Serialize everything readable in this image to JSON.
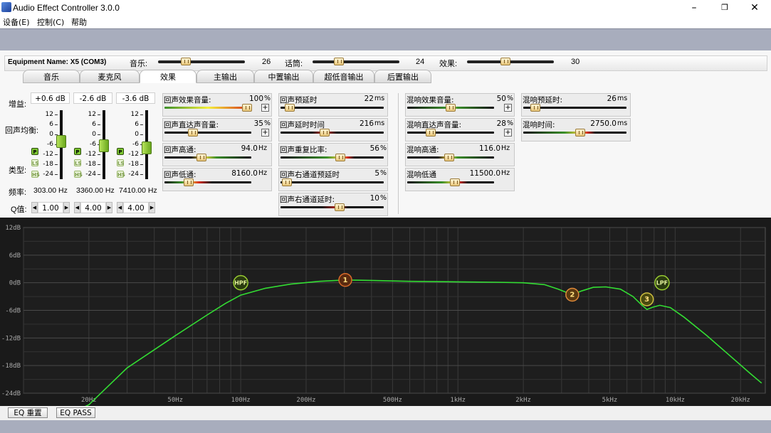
{
  "window": {
    "title": "Audio Effect Controller 3.0.0",
    "minimize": "–",
    "maximize": "❐",
    "close": "✕"
  },
  "menu": [
    "设备(E)",
    "控制(C)",
    "帮助"
  ],
  "equipment": {
    "name": "Equipment Name: X5 (COM3)",
    "sliders": [
      {
        "label": "音乐:",
        "value": "26",
        "pos": 0.32
      },
      {
        "label": "话筒:",
        "value": "24",
        "pos": 0.3
      },
      {
        "label": "效果:",
        "value": "30",
        "pos": 0.44
      }
    ]
  },
  "tabs": [
    "音乐",
    "麦克风",
    "效果",
    "主输出",
    "中置输出",
    "超低音输出",
    "后置输出"
  ],
  "left": {
    "gain_label": "增益:",
    "echo_eq_label": "回声均衡:",
    "type_label": "类型:",
    "freq_label": "频率:",
    "q_label": "Q值:",
    "ticks": [
      "12",
      "6",
      "0",
      "-6",
      "-12",
      "-18",
      "-24"
    ],
    "badges": [
      "P",
      "LS",
      "HS"
    ],
    "bands": [
      {
        "gain": "+0.6 dB",
        "freq": "303.00 Hz",
        "q": "1.00",
        "level": 0.45
      },
      {
        "gain": "-2.6 dB",
        "freq": "3360.00 Hz",
        "q": "4.00",
        "level": 0.52
      },
      {
        "gain": "-3.6 dB",
        "freq": "7410.00 Hz",
        "q": "4.00",
        "level": 0.55
      }
    ]
  },
  "echo_col1": [
    {
      "title": "回声效果音量:",
      "value": "100",
      "unit": "%",
      "pos": 0.95,
      "plus": true,
      "grad": "linear-gradient(90deg,#3a8f2a,#f5f03a,#d42a1a)"
    },
    {
      "title": "回声直达声音量:",
      "value": "35",
      "unit": "%",
      "pos": 0.33,
      "plus": true,
      "grad": ""
    },
    {
      "title": "回声高通:",
      "value": "94.0",
      "unit": "Hz",
      "pos": 0.43,
      "plus": false,
      "grad": "linear-gradient(90deg,#111,#111 30%,#f5d23a 45%,#3a8f2a 60%,#111)"
    },
    {
      "title": "回声低通:",
      "value": "8160.0",
      "unit": "Hz",
      "pos": 0.28,
      "plus": false,
      "grad": "linear-gradient(90deg,#111,#3a8f2a 20%,#f5d23a 28%,#d42a1a 40%,#111 55%)"
    }
  ],
  "echo_col2": [
    {
      "title": "回声预延时",
      "value": "22",
      "unit": "ms",
      "pos": 0.09,
      "grad": ""
    },
    {
      "title": "回声延时时间",
      "value": "216",
      "unit": "ms",
      "pos": 0.43,
      "grad": "linear-gradient(90deg,#111,#111 30%,#d42a1a 43%,#111 55%)"
    },
    {
      "title": "回声重复比率:",
      "value": "56",
      "unit": "%",
      "pos": 0.58,
      "grad": "linear-gradient(90deg,#111,#3a8f2a 45%,#f5d23a 58%,#d42a1a 65%,#111 72%)"
    },
    {
      "title": "回声右通道预延时",
      "value": "5",
      "unit": "%",
      "pos": 0.06,
      "grad": ""
    },
    {
      "title": "回声右通道延时:",
      "value": "10",
      "unit": "%",
      "pos": 0.57,
      "grad": "linear-gradient(90deg,#111,#111 40%,#d42a1a 57%,#111 65%)"
    }
  ],
  "reverb_col1": [
    {
      "title": "混响效果音量:",
      "value": "50",
      "unit": "%",
      "pos": 0.5,
      "plus": true,
      "grad": "linear-gradient(90deg,#111,#3a8f2a 45%,#f5d23a 50%,#3a8f2a 58%,#111)"
    },
    {
      "title": "混响直达声音量:",
      "value": "28",
      "unit": "%",
      "pos": 0.27,
      "plus": true,
      "grad": ""
    },
    {
      "title": "混响高通:",
      "value": "116.0",
      "unit": "Hz",
      "pos": 0.48,
      "plus": false,
      "grad": "linear-gradient(90deg,#111,#111 35%,#f5d23a 48%,#3a8f2a 58%,#111)"
    },
    {
      "title": "混响低通",
      "value": "11500.0",
      "unit": "Hz",
      "pos": 0.55,
      "plus": false,
      "grad": "linear-gradient(90deg,#111,#3a8f2a 40%,#f5d23a 55%,#d42a1a 60%,#111 70%)"
    }
  ],
  "reverb_col2": [
    {
      "title": "混响预延时:",
      "value": "26",
      "unit": "ms",
      "pos": 0.12,
      "grad": ""
    },
    {
      "title": "混响时间:",
      "value": "2750.0",
      "unit": "ms",
      "pos": 0.55,
      "grad": "linear-gradient(90deg,#111,#3a8f2a 40%,#f5d23a 55%,#d42a1a 62%,#111 70%)"
    }
  ],
  "eq": {
    "y_labels": [
      "12dB",
      "6dB",
      "0dB",
      "-6dB",
      "-12dB",
      "-18dB",
      "-24dB"
    ],
    "x_labels": [
      {
        "t": "20Hz",
        "f": 20
      },
      {
        "t": "50Hz",
        "f": 50
      },
      {
        "t": "100Hz",
        "f": 100
      },
      {
        "t": "200Hz",
        "f": 200
      },
      {
        "t": "500Hz",
        "f": 500
      },
      {
        "t": "1kHz",
        "f": 1000
      },
      {
        "t": "2kHz",
        "f": 2000
      },
      {
        "t": "5kHz",
        "f": 5000
      },
      {
        "t": "10kHz",
        "f": 10000
      },
      {
        "t": "20kHz",
        "f": 20000
      }
    ],
    "fmin": 10,
    "fmax": 26000,
    "dbmin": -24,
    "dbmax": 12,
    "curve": [
      [
        14,
        -30
      ],
      [
        20,
        -26.5
      ],
      [
        30,
        -18.5
      ],
      [
        50,
        -11.5
      ],
      [
        70,
        -7
      ],
      [
        85,
        -4.5
      ],
      [
        100,
        -2.7
      ],
      [
        130,
        -1.2
      ],
      [
        170,
        -0.3
      ],
      [
        230,
        0.3
      ],
      [
        303,
        0.6
      ],
      [
        400,
        0.5
      ],
      [
        600,
        0.3
      ],
      [
        1000,
        0.2
      ],
      [
        1500,
        0.1
      ],
      [
        2000,
        0.0
      ],
      [
        2500,
        -0.4
      ],
      [
        2900,
        -1.4
      ],
      [
        3360,
        -2.6
      ],
      [
        3700,
        -1.8
      ],
      [
        4200,
        -1.0
      ],
      [
        4800,
        -0.9
      ],
      [
        5600,
        -1.4
      ],
      [
        6400,
        -3.0
      ],
      [
        7000,
        -4.8
      ],
      [
        7410,
        -5.8
      ],
      [
        7900,
        -5.3
      ],
      [
        8500,
        -4.9
      ],
      [
        9500,
        -5.4
      ],
      [
        11000,
        -7.5
      ],
      [
        14000,
        -11.5
      ],
      [
        18000,
        -16
      ],
      [
        22000,
        -19.6
      ],
      [
        25000,
        -21.8
      ]
    ],
    "markers": [
      {
        "label": "HPF",
        "f": 100,
        "db": 0,
        "color": "#2a3a10",
        "ring": "#9acd32"
      },
      {
        "label": "1",
        "f": 303,
        "db": 0.6,
        "color": "#5a2a10",
        "ring": "#d86a2a"
      },
      {
        "label": "2",
        "f": 3360,
        "db": -2.6,
        "color": "#5a3a10",
        "ring": "#e08a3a"
      },
      {
        "label": "3",
        "f": 7410,
        "db": -3.6,
        "color": "#4a4a10",
        "ring": "#d0c040"
      },
      {
        "label": "LPF",
        "f": 8700,
        "db": 0,
        "color": "#2a3a10",
        "ring": "#9acd32"
      }
    ],
    "curve_color": "#33dd33"
  },
  "buttons": {
    "eq_reset": "EQ 重置",
    "eq_pass": "EQ PASS"
  }
}
